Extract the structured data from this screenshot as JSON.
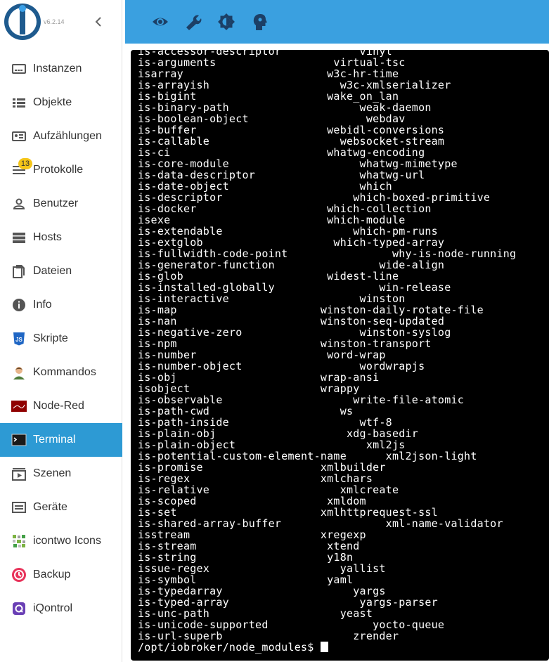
{
  "app": {
    "version": "v6.2.14",
    "collapse_icon": "chevron-left-icon",
    "brand_colors": {
      "logo": "#1e5a8e",
      "header": "#3aa0e0",
      "active": "#2d9ad4"
    }
  },
  "sidebar": {
    "items": [
      {
        "label": "Instanzen",
        "icon": "instances-icon"
      },
      {
        "label": "Objekte",
        "icon": "list-icon"
      },
      {
        "label": "Aufzählungen",
        "icon": "enum-icon"
      },
      {
        "label": "Protokolle",
        "icon": "log-icon",
        "badge": "13"
      },
      {
        "label": "Benutzer",
        "icon": "user-icon"
      },
      {
        "label": "Hosts",
        "icon": "server-icon"
      },
      {
        "label": "Dateien",
        "icon": "file-icon"
      },
      {
        "label": "Info",
        "icon": "info-icon"
      },
      {
        "label": "Skripte",
        "icon": "javascript-icon"
      },
      {
        "label": "Kommandos",
        "icon": "person-icon"
      },
      {
        "label": "Node-Red",
        "icon": "node-red-icon"
      },
      {
        "label": "Terminal",
        "icon": "terminal-icon",
        "active": true
      },
      {
        "label": "Szenen",
        "icon": "scenes-icon"
      },
      {
        "label": "Geräte",
        "icon": "devices-icon"
      },
      {
        "label": "icontwo Icons",
        "icon": "icontwo-icon"
      },
      {
        "label": "Backup",
        "icon": "backup-icon"
      },
      {
        "label": "iQontrol",
        "icon": "iqontrol-icon"
      }
    ]
  },
  "header": {
    "buttons": [
      "eye-icon",
      "wrench-icon",
      "brightness-icon",
      "head-icon"
    ]
  },
  "terminal": {
    "lines": [
      "is-accessor-descriptor            vinyl",
      "is-arguments                  virtual-tsc",
      "isarray                      w3c-hr-time",
      "is-arrayish                    w3c-xmlserializer",
      "is-bigint                    wake_on_lan",
      "is-binary-path                    weak-daemon",
      "is-boolean-object                  webdav",
      "is-buffer                    webidl-conversions",
      "is-callable                    websocket-stream",
      "is-ci                        whatwg-encoding",
      "is-core-module                    whatwg-mimetype",
      "is-data-descriptor                whatwg-url",
      "is-date-object                    which",
      "is-descriptor                    which-boxed-primitive",
      "is-docker                    which-collection",
      "isexe                        which-module",
      "is-extendable                    which-pm-runs",
      "is-extglob                    which-typed-array",
      "is-fullwidth-code-point                why-is-node-running",
      "is-generator-function                wide-align",
      "is-glob                      widest-line",
      "is-installed-globally                win-release",
      "is-interactive                    winston",
      "is-map                      winston-daily-rotate-file",
      "is-nan                      winston-seq-updated",
      "is-negative-zero                  winston-syslog",
      "is-npm                      winston-transport",
      "is-number                    word-wrap",
      "is-number-object                  wordwrapjs",
      "is-obj                      wrap-ansi",
      "isobject                    wrappy",
      "is-observable                    write-file-atomic",
      "is-path-cwd                    ws",
      "is-path-inside                    wtf-8",
      "is-plain-obj                    xdg-basedir",
      "is-plain-object                    xml2js",
      "is-potential-custom-element-name      xml2json-light",
      "is-promise                  xmlbuilder",
      "is-regex                    xmlchars",
      "is-relative                    xmlcreate",
      "is-scoped                    xmldom",
      "is-set                      xmlhttprequest-ssl",
      "is-shared-array-buffer                xml-name-validator",
      "isstream                    xregexp",
      "is-stream                    xtend",
      "is-string                    y18n",
      "issue-regex                    yallist",
      "is-symbol                    yaml",
      "is-typedarray                    yargs",
      "is-typed-array                    yargs-parser",
      "is-unc-path                    yeast",
      "is-unicode-supported                yocto-queue",
      "is-url-superb                    zrender"
    ],
    "prompt": "/opt/iobroker/node_modules$ "
  }
}
